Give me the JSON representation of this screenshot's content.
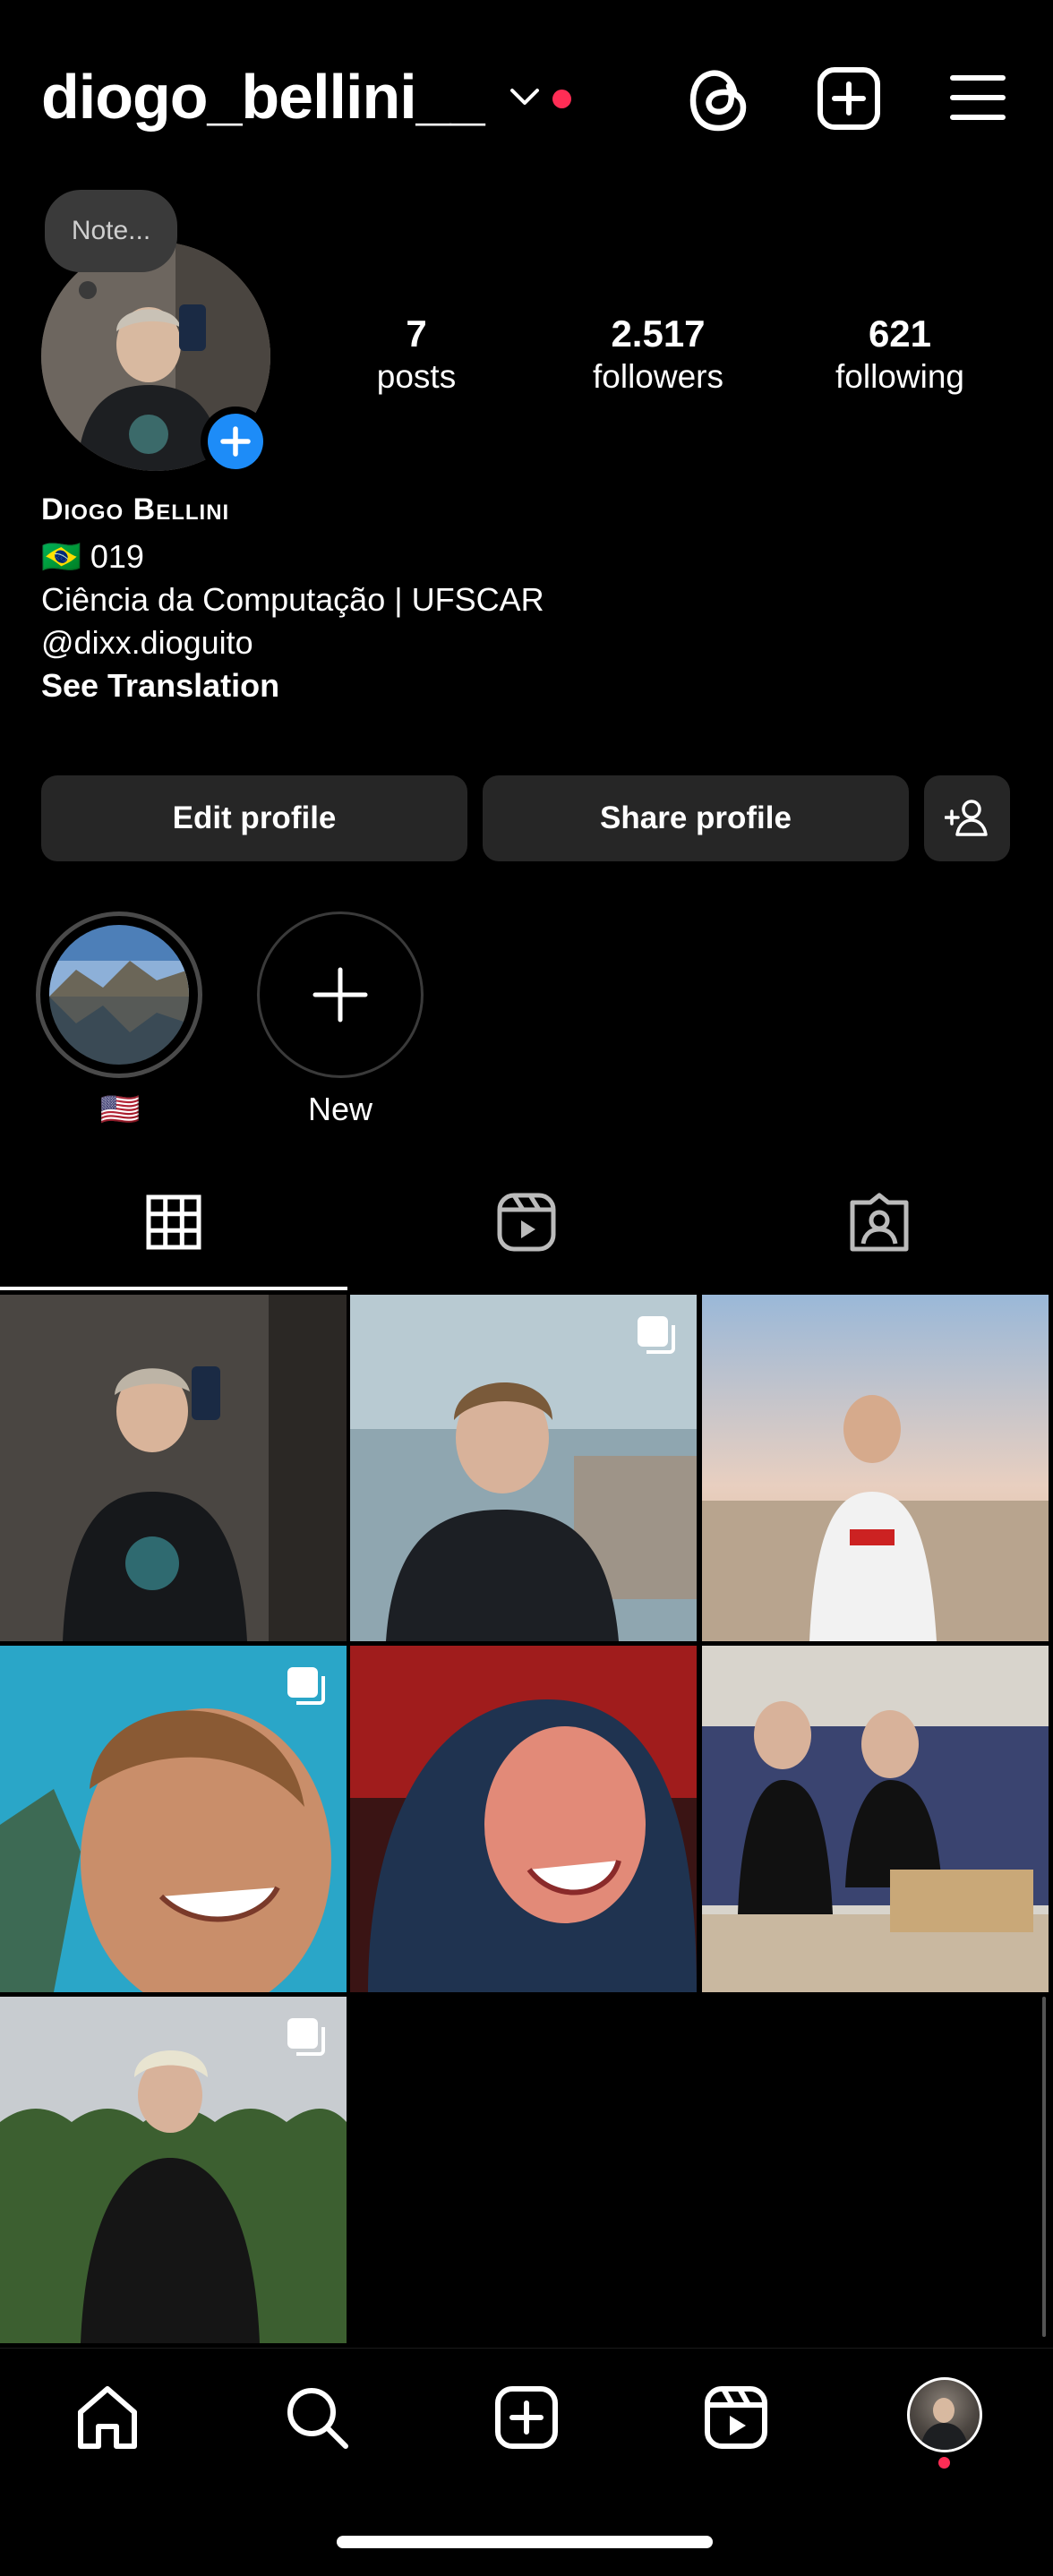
{
  "header": {
    "username": "diogo_bellini__",
    "accent_dot_color": "#ff2d55",
    "icons": [
      "chevron-down-icon",
      "threads-icon",
      "new-post-icon",
      "menu-icon"
    ]
  },
  "note": {
    "placeholder": "Note..."
  },
  "stats": [
    {
      "value": "7",
      "label": "posts"
    },
    {
      "value": "2.517",
      "label": "followers"
    },
    {
      "value": "621",
      "label": "following"
    }
  ],
  "bio": {
    "name": "Diogo Bellini",
    "lines": [
      "🇧🇷 019",
      "Ciência da Computação | UFSCAR",
      "@dixx.dioguito"
    ],
    "see_translation": "See Translation"
  },
  "buttons": {
    "edit": "Edit profile",
    "share": "Share profile"
  },
  "highlights": [
    {
      "label": "🇺🇸",
      "type": "story"
    },
    {
      "label": "New",
      "type": "add"
    }
  ],
  "tabs": [
    "grid-icon",
    "reels-icon",
    "tagged-icon"
  ],
  "grid": [
    {
      "multi": false,
      "tone": "mirror-selfie"
    },
    {
      "multi": true,
      "tone": "cafe-selfie"
    },
    {
      "multi": false,
      "tone": "beach-sunset"
    },
    {
      "multi": true,
      "tone": "sky-selfie"
    },
    {
      "multi": false,
      "tone": "red-light-selfie"
    },
    {
      "multi": false,
      "tone": "sofa-photo"
    },
    {
      "multi": true,
      "tone": "outdoor-pose"
    }
  ],
  "bottom_nav": [
    "home-icon",
    "search-icon",
    "create-icon",
    "reels-icon",
    "profile-avatar"
  ]
}
